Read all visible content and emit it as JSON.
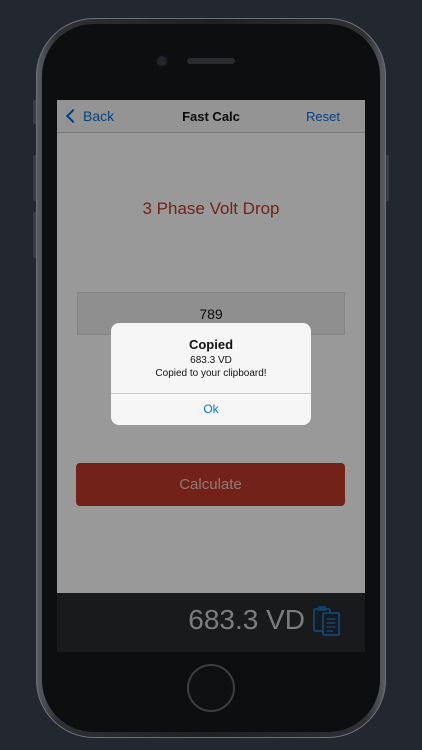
{
  "nav": {
    "back_label": "Back",
    "title": "Fast Calc",
    "reset_label": "Reset"
  },
  "main": {
    "heading": "3 Phase Volt Drop",
    "input_value": "789",
    "calculate_label": "Calculate"
  },
  "result": {
    "value": "683.3 VD",
    "copy_icon": "clipboard-icon"
  },
  "alert": {
    "title": "Copied",
    "line1": "683.3 VD",
    "line2": "Copied to your clipboard!",
    "ok_label": "Ok"
  },
  "colors": {
    "accent": "#c0392b",
    "link": "#0a6fd9",
    "background": "#232730"
  }
}
